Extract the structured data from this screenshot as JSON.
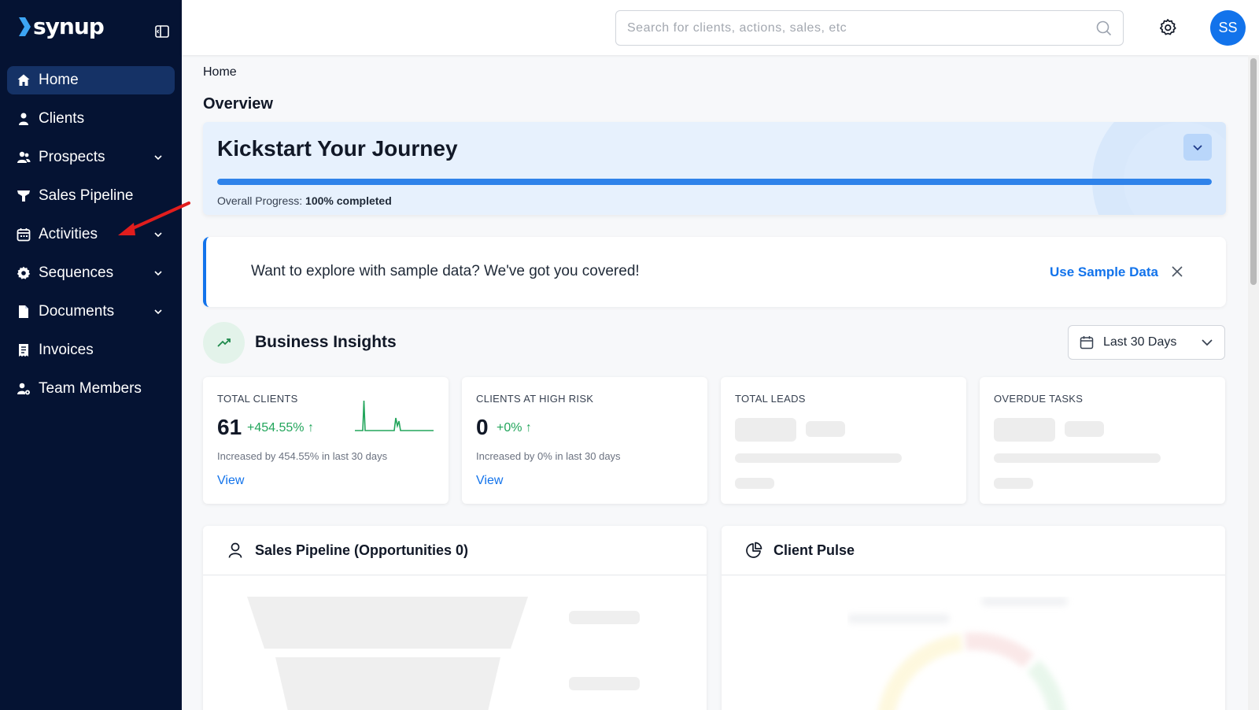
{
  "brand": {
    "logo_text": "synup"
  },
  "sidebar": {
    "items": [
      {
        "label": "Home",
        "icon": "home-icon",
        "active": true,
        "has_chevron": false
      },
      {
        "label": "Clients",
        "icon": "user-icon",
        "active": false,
        "has_chevron": false
      },
      {
        "label": "Prospects",
        "icon": "users-icon",
        "active": false,
        "has_chevron": true
      },
      {
        "label": "Sales Pipeline",
        "icon": "funnel-icon",
        "active": false,
        "has_chevron": false
      },
      {
        "label": "Activities",
        "icon": "calendar-icon",
        "active": false,
        "has_chevron": true
      },
      {
        "label": "Sequences",
        "icon": "cog-icon",
        "active": false,
        "has_chevron": true
      },
      {
        "label": "Documents",
        "icon": "document-icon",
        "active": false,
        "has_chevron": true
      },
      {
        "label": "Invoices",
        "icon": "invoice-icon",
        "active": false,
        "has_chevron": false
      },
      {
        "label": "Team Members",
        "icon": "team-icon",
        "active": false,
        "has_chevron": false
      }
    ]
  },
  "topbar": {
    "search_placeholder": "Search for clients, actions, sales, etc",
    "avatar_initials": "SS"
  },
  "main": {
    "breadcrumb": "Home",
    "title": "Overview",
    "journey": {
      "title": "Kickstart Your Journey",
      "progress_label": "Overall Progress:",
      "progress_value": "100% completed",
      "progress_fraction": 1.0
    },
    "sample_banner": {
      "text": "Want to explore with sample data? We've got you covered!",
      "action": "Use Sample Data"
    },
    "insights": {
      "title": "Business Insights",
      "range": "Last 30 Days"
    },
    "cards": [
      {
        "title": "TOTAL CLIENTS",
        "value": "61",
        "delta": "+454.55% ↑",
        "desc": "Increased by 454.55% in last 30 days",
        "link": "View"
      },
      {
        "title": "CLIENTS AT HIGH RISK",
        "value": "0",
        "delta": "+0% ↑",
        "desc": "Increased by 0% in last 30 days",
        "link": "View"
      },
      {
        "title": "TOTAL LEADS"
      },
      {
        "title": "OVERDUE TASKS"
      }
    ],
    "panels": {
      "pipeline_title": "Sales Pipeline (Opportunities 0)",
      "pulse_title": "Client Pulse"
    }
  },
  "colors": {
    "sidebar_bg": "#051333",
    "sidebar_active": "#153266",
    "accent": "#1273eb",
    "positive": "#22a55b",
    "annotation_arrow": "#e11d1d"
  }
}
